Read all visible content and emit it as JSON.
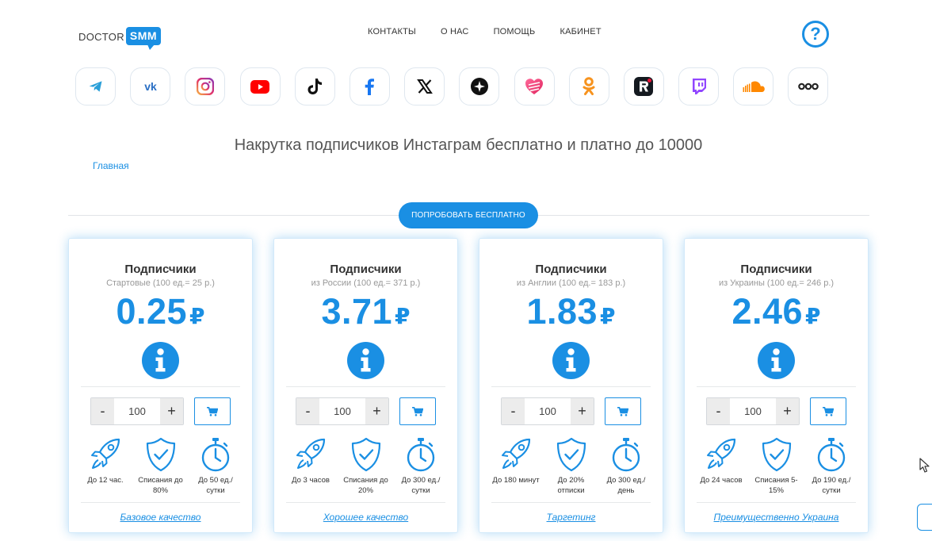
{
  "logo": {
    "doctor": "DOCTOR",
    "smm": "SMM"
  },
  "nav": [
    {
      "label": "КОНТАКТЫ"
    },
    {
      "label": "О НАС"
    },
    {
      "label": "ПОМОЩЬ"
    },
    {
      "label": "КАБИНЕТ"
    }
  ],
  "help_icon": "question-circle-icon",
  "socials": [
    {
      "name": "telegram"
    },
    {
      "name": "vk"
    },
    {
      "name": "instagram"
    },
    {
      "name": "youtube"
    },
    {
      "name": "tiktok"
    },
    {
      "name": "facebook"
    },
    {
      "name": "x"
    },
    {
      "name": "threads"
    },
    {
      "name": "likee"
    },
    {
      "name": "odnoklassniki"
    },
    {
      "name": "rutube"
    },
    {
      "name": "twitch"
    },
    {
      "name": "soundcloud"
    },
    {
      "name": "more"
    }
  ],
  "page_title": "Накрутка подписчиков Инстаграм бесплатно и платно до 10000",
  "breadcrumb": "Главная",
  "try_button": "ПОПРОБОВАТЬ БЕСПЛАТНО",
  "colors": {
    "accent": "#1a8fe3"
  },
  "cards": [
    {
      "title": "Подписчики",
      "subtitle": "Стартовые (100 ед.= 25 р.)",
      "price": "0.25",
      "currency": "₽",
      "qty": "100",
      "minus": "-",
      "plus": "+",
      "feat1": "До 12 час.",
      "feat2": "Списания до 80%",
      "feat3": "До 50 ед./ сутки",
      "quality": "Базовое качество"
    },
    {
      "title": "Подписчики",
      "subtitle": "из России (100 ед.= 371 р.)",
      "price": "3.71",
      "currency": "₽",
      "qty": "100",
      "minus": "-",
      "plus": "+",
      "feat1": "До 3 часов",
      "feat2": "Списания до 20%",
      "feat3": "До 300 ед./ сутки",
      "quality": "Хорошее качество"
    },
    {
      "title": "Подписчики",
      "subtitle": "из Англии (100 ед.= 183 р.)",
      "price": "1.83",
      "currency": "₽",
      "qty": "100",
      "minus": "-",
      "plus": "+",
      "feat1": "До 180 минут",
      "feat2": "До 20% отписки",
      "feat3": "До 300 ед./ день",
      "quality": "Таргетинг"
    },
    {
      "title": "Подписчики",
      "subtitle": "из Украины (100 ед.= 246 р.)",
      "price": "2.46",
      "currency": "₽",
      "qty": "100",
      "minus": "-",
      "plus": "+",
      "feat1": "До 24 часов",
      "feat2": "Списания 5-15%",
      "feat3": "До 190 ед./ сутки",
      "quality": "Преимущественно Украина"
    }
  ]
}
